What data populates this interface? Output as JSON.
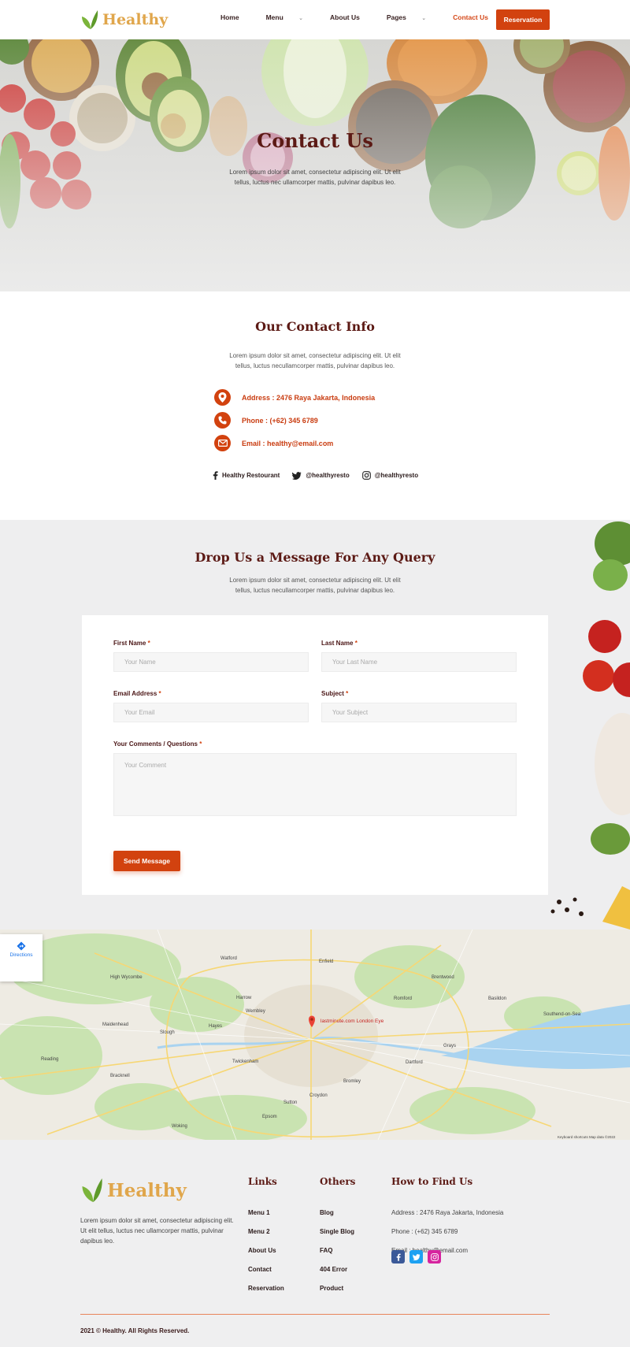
{
  "nav": {
    "brand": "Healthy",
    "items": [
      {
        "label": "Home",
        "caret": false,
        "active": false
      },
      {
        "label": "Menu",
        "caret": true,
        "active": false
      },
      {
        "label": "About Us",
        "caret": false,
        "active": false
      },
      {
        "label": "Pages",
        "caret": true,
        "active": false
      },
      {
        "label": "Contact Us",
        "caret": false,
        "active": true
      }
    ],
    "cta": "Reservation"
  },
  "hero": {
    "title": "Contact Us",
    "subtitle": "Lorem ipsum dolor sit amet, consectetur adipiscing elit. Ut elit tellus, luctus nec ullamcorper mattis, pulvinar dapibus leo."
  },
  "contact_info": {
    "title": "Our Contact Info",
    "subtitle": "Lorem ipsum dolor sit amet, consectetur adipiscing elit. Ut elit tellus, luctus necullamcorper mattis, pulvinar dapibus leo.",
    "address": "Address : 2476 Raya Jakarta, Indonesia",
    "phone": "Phone : (+62) 345 6789",
    "email": "Email : healthy@email.com",
    "facebook": "Healthy Restourant",
    "twitter": "@healthyresto",
    "instagram": "@healthyresto"
  },
  "message": {
    "title": "Drop Us a Message For Any Query",
    "subtitle": "Lorem ipsum dolor sit amet, consectetur adipiscing elit. Ut elit tellus, luctus necullamcorper mattis, pulvinar dapibus leo.",
    "first_name_label": "First Name",
    "first_name_placeholder": "Your Name",
    "last_name_label": "Last Name",
    "last_name_placeholder": "Your Last Name",
    "email_label": "Email Address",
    "email_placeholder": "Your Email",
    "subject_label": "Subject",
    "subject_placeholder": "Your Subject",
    "comments_label": "Your Comments / Questions",
    "comments_placeholder": "Your Comment",
    "required_mark": "*",
    "send": "Send Message"
  },
  "map": {
    "directions": "Directions",
    "pin_title": "lastminute.com London Eye",
    "places": [
      "Watford",
      "High Wycombe",
      "Enfield",
      "Brentwood",
      "Romford",
      "Basildon",
      "Southend-on-Sea",
      "Harrow",
      "Wembley",
      "Slough",
      "Maidenhead",
      "Hayes",
      "Reading",
      "Twickenham",
      "Bracknell",
      "Croydon",
      "Dartford",
      "Grays",
      "Sutton",
      "Epsom",
      "Bromley",
      "Woking"
    ],
    "footer_note": "Keyboard shortcuts   Map data ©2022"
  },
  "footer": {
    "brand": "Healthy",
    "about": "Lorem ipsum dolor sit amet, consectetur adipiscing elit. Ut elit tellus, luctus nec ullamcorper mattis, pulvinar dapibus leo.",
    "links_title": "Links",
    "links": [
      "Menu 1",
      "Menu 2",
      "About Us",
      "Contact",
      "Reservation"
    ],
    "others_title": "Others",
    "others": [
      "Blog",
      "Single Blog",
      "FAQ",
      "404 Error",
      "Product"
    ],
    "find_title": "How to Find Us",
    "address": "Address : 2476 Raya Jakarta, Indonesia",
    "phone": "Phone : (+62) 345 6789",
    "email": "Email : healthy@email.com",
    "copyright": "2021 © Healthy. All Rights Reserved."
  },
  "colors": {
    "accent": "#d2420f",
    "brand_title": "#5c1a15",
    "logo": "#e0a64b",
    "leaf": "#7bb43a"
  }
}
